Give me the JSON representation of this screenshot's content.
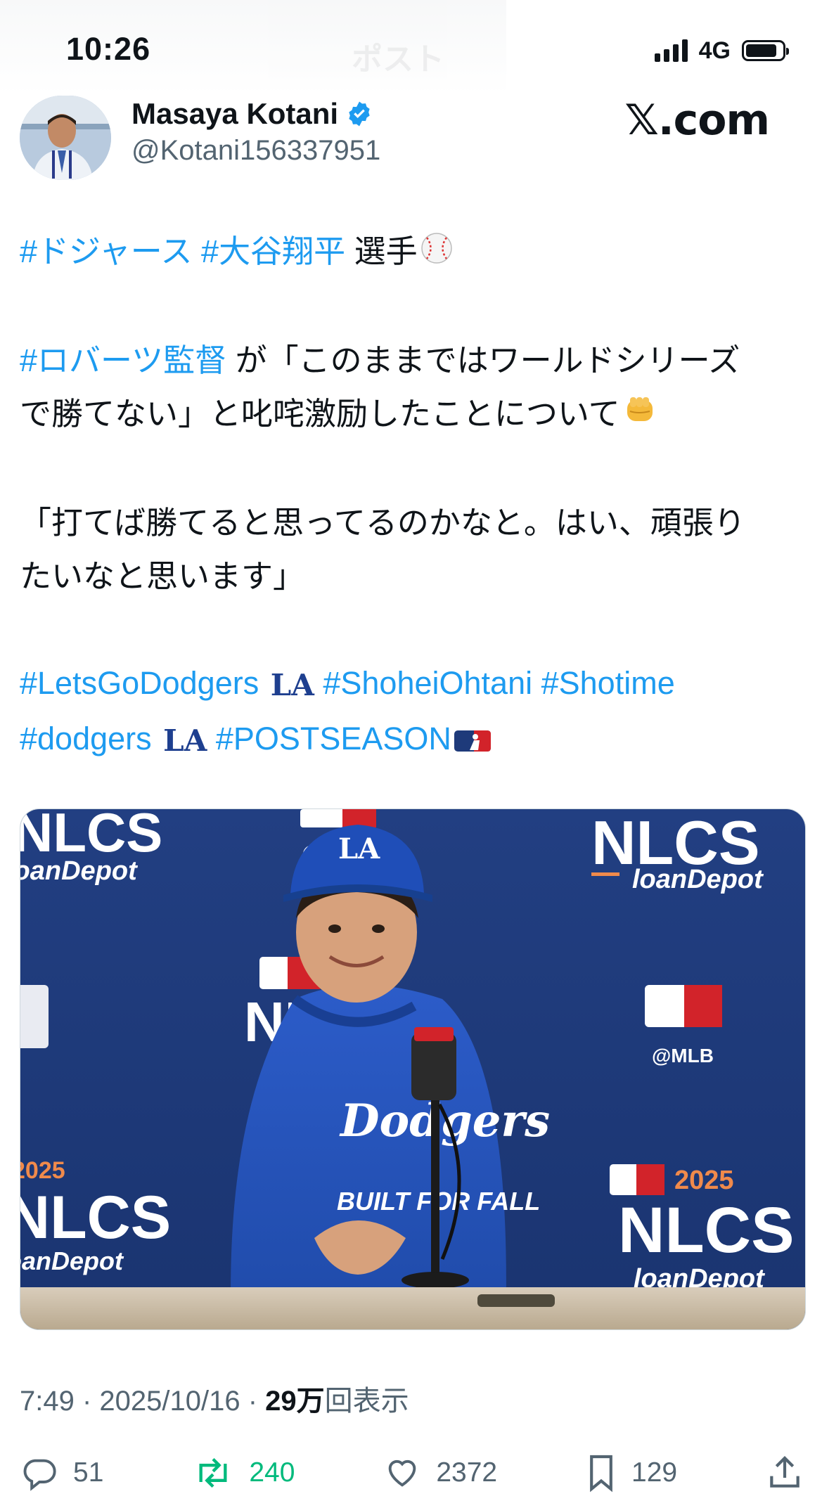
{
  "status_bar": {
    "time": "10:26",
    "network": "4G",
    "battery_level": 0.85,
    "background_title": "ポスト"
  },
  "author": {
    "display_name": "Masaya Kotani",
    "handle": "@Kotani156337951",
    "verified_icon": "verified-badge-icon",
    "watermark": "𝕏.com"
  },
  "tweet": {
    "line1": {
      "tag1": "#ドジャース",
      "tag2": "#大谷翔平",
      "text": " 選手",
      "emoji": "⚾"
    },
    "line2": {
      "tag": "#ロバーツ監督",
      "text_a": " が「このままではワールドシリーズ",
      "text_b": "で勝てない」と叱咤激励したことについて",
      "emoji": "👊"
    },
    "line3": {
      "text_a": "「打てば勝てると思ってるのかなと。はい、頑張り",
      "text_b": "たいなと思います」"
    },
    "tags_row1": {
      "a": "#LetsGoDodgers",
      "b": "#ShoheiOhtani",
      "c": "#Shotime"
    },
    "tags_row2": {
      "a": "#dodgers",
      "b": "#POSTSEASON"
    }
  },
  "media": {
    "backdrop_texts": {
      "nlcs": "NLCS",
      "loandepot": "loanDepot",
      "mlb": "@MLB",
      "year": "2025",
      "jersey_top": "Dodgers",
      "jersey_bottom": "BUILT FOR FALL"
    }
  },
  "meta": {
    "time": "7:49",
    "date": "2025/10/16",
    "views_number": "29万",
    "views_label": "回表示",
    "separator": " · "
  },
  "actions": {
    "replies": "51",
    "reposts": "240",
    "likes": "2372",
    "bookmarks": "129"
  },
  "colors": {
    "link": "#1d9bf0",
    "repost": "#00ba7c",
    "secondary": "#536471",
    "backdrop": "#1f3d80"
  }
}
